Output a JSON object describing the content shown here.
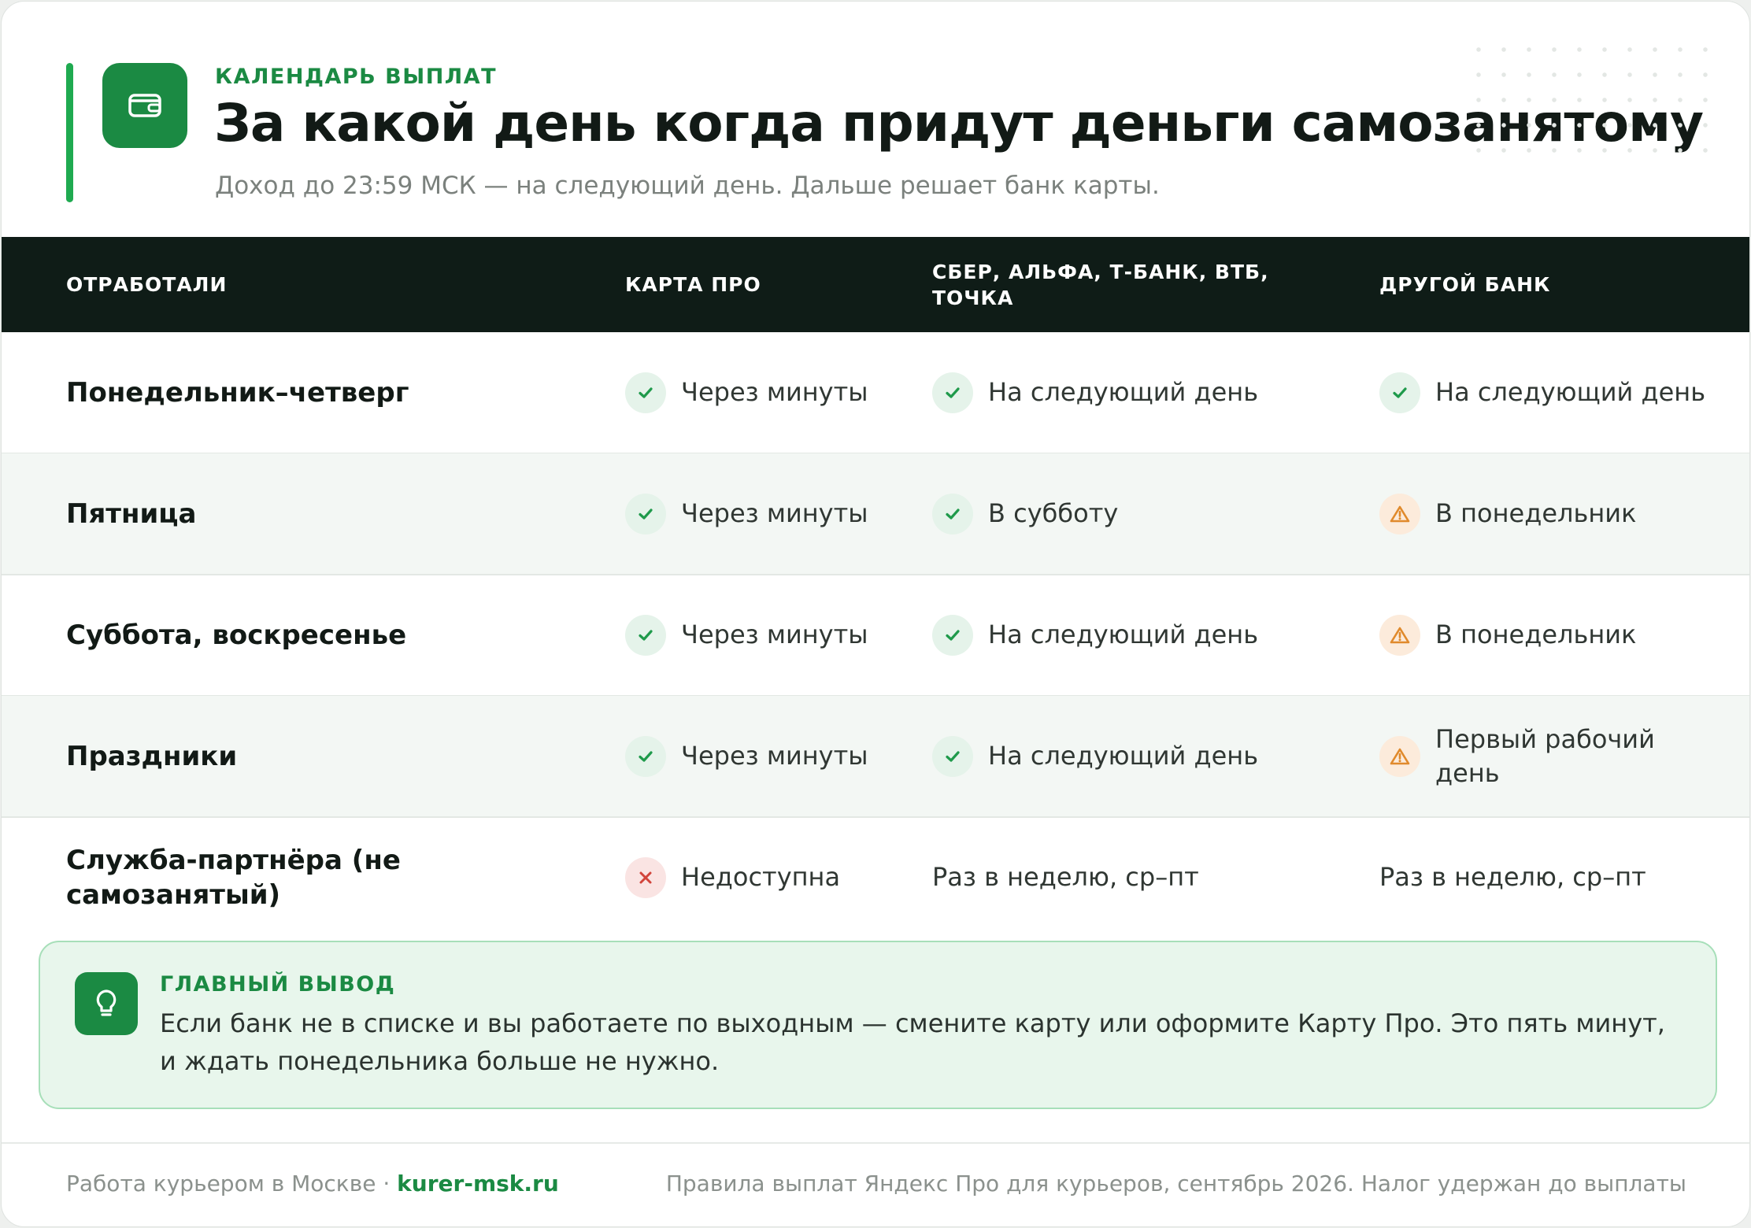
{
  "header": {
    "eyebrow": "КАЛЕНДАРЬ ВЫПЛАТ",
    "title": "За какой день когда придут деньги самозанятому",
    "subtitle": "Доход до 23:59 МСК — на следующий день. Дальше решает банк карты."
  },
  "table": {
    "columns": [
      "ОТРАБОТАЛИ",
      "КАРТА ПРО",
      "СБЕР, АЛЬФА, Т-БАНК, ВТБ, ТОЧКА",
      "ДРУГОЙ БАНК"
    ],
    "rows": [
      {
        "label": "Понедельник–четверг",
        "cells": [
          {
            "status": "ok",
            "icon": "check-icon",
            "text": "Через минуты"
          },
          {
            "status": "ok",
            "icon": "check-icon",
            "text": "На следующий день"
          },
          {
            "status": "ok",
            "icon": "check-icon",
            "text": "На следующий день"
          }
        ]
      },
      {
        "label": "Пятница",
        "cells": [
          {
            "status": "ok",
            "icon": "check-icon",
            "text": "Через минуты"
          },
          {
            "status": "ok",
            "icon": "check-icon",
            "text": "В субботу"
          },
          {
            "status": "warn",
            "icon": "warning-icon",
            "text": "В понедельник"
          }
        ]
      },
      {
        "label": "Суббота, воскресенье",
        "cells": [
          {
            "status": "ok",
            "icon": "check-icon",
            "text": "Через минуты"
          },
          {
            "status": "ok",
            "icon": "check-icon",
            "text": "На следующий день"
          },
          {
            "status": "warn",
            "icon": "warning-icon",
            "text": "В понедельник"
          }
        ]
      },
      {
        "label": "Праздники",
        "cells": [
          {
            "status": "ok",
            "icon": "check-icon",
            "text": "Через минуты"
          },
          {
            "status": "ok",
            "icon": "check-icon",
            "text": "На следующий день"
          },
          {
            "status": "warn",
            "icon": "warning-icon",
            "text": "Первый рабочий день"
          }
        ]
      },
      {
        "label": "Служба-партнёра (не самозанятый)",
        "cells": [
          {
            "status": "no",
            "icon": "cross-icon",
            "text": "Недоступна"
          },
          {
            "status": "none",
            "icon": "",
            "text": "Раз в неделю, ср–пт"
          },
          {
            "status": "none",
            "icon": "",
            "text": "Раз в неделю, ср–пт"
          }
        ]
      }
    ]
  },
  "conclusion": {
    "label": "ГЛАВНЫЙ ВЫВОД",
    "icon": "lightbulb-icon",
    "text": "Если банк не в списке и вы работаете по выходным — смените карту или оформите Карту Про. Это пять минут, и ждать понедельника больше не нужно."
  },
  "footer": {
    "left_text": "Работа курьером в Москве · ",
    "site": "kurer-msk.ru",
    "right_text": "Правила выплат Яндекс Про для курьеров, сентябрь 2026. Налог удержан до выплаты"
  },
  "colors": {
    "accent": "#1b8a43",
    "ok": "#1f9a4b",
    "warn": "#e08a2c",
    "no": "#d2443b",
    "header_bg": "#0f1c17"
  }
}
